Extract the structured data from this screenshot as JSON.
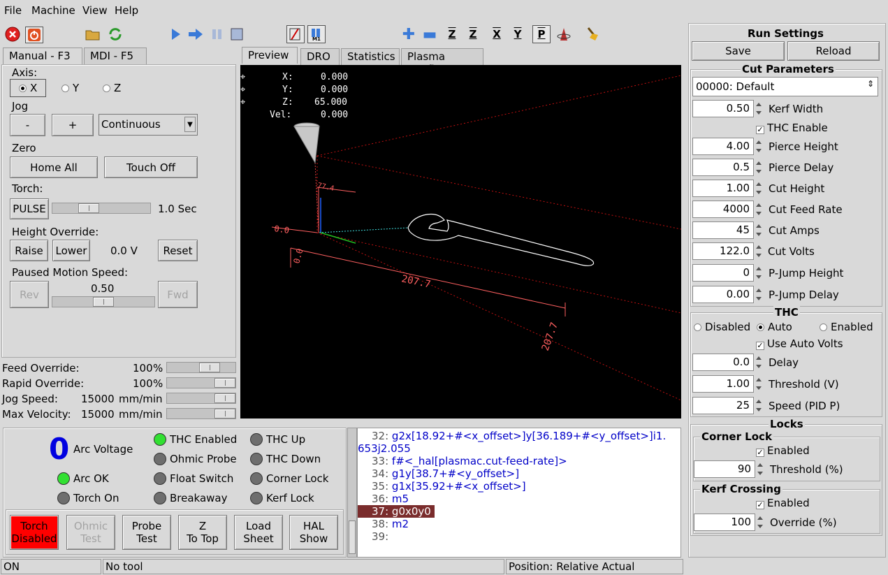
{
  "menu": [
    "File",
    "Machine",
    "View",
    "Help"
  ],
  "left_tabs": [
    "Manual - F3",
    "MDI - F5"
  ],
  "center_tabs": [
    "Preview",
    "DRO",
    "Statistics",
    "Plasma Config"
  ],
  "manual": {
    "axis_label": "Axis:",
    "axes": [
      "X",
      "Y",
      "Z"
    ],
    "jog_label": "Jog",
    "jog_minus": "-",
    "jog_plus": "+",
    "jog_mode": "Continuous",
    "zero_label": "Zero",
    "home_all": "Home All",
    "touch_off": "Touch Off",
    "torch_label": "Torch:",
    "pulse": "PULSE",
    "pulse_time": "1.0 Sec",
    "pulse_level": 0.3,
    "height_override_label": "Height Override:",
    "raise": "Raise",
    "lower": "Lower",
    "override_value": "0.0 V",
    "reset": "Reset",
    "paused_motion_label": "Paused Motion Speed:",
    "rev": "Rev",
    "fwd": "Fwd",
    "paused_speed": "0.50"
  },
  "overrides": [
    {
      "label": "Feed Override:",
      "value": "100",
      "unit": "%"
    },
    {
      "label": "Rapid Override:",
      "value": "100",
      "unit": "%"
    },
    {
      "label": "Jog Speed:",
      "value": "15000",
      "unit": "mm/min"
    },
    {
      "label": "Max Velocity:",
      "value": "15000",
      "unit": "mm/min"
    }
  ],
  "dro": {
    "x_label": "X:",
    "x": "0.000",
    "y_label": "Y:",
    "y": "0.000",
    "z_label": "Z:",
    "z": "65.000",
    "vel_label": "Vel:",
    "vel": "0.000"
  },
  "preview_dims": {
    "x_len": "207.7",
    "y_len": "207.7",
    "origin_x": "0.0",
    "origin_y": "0.0",
    "z_len": "77.4"
  },
  "status_panel": {
    "arc_voltage_value": "0",
    "arc_voltage_label": "Arc Voltage",
    "leds": [
      {
        "label": "Arc OK",
        "state": "green"
      },
      {
        "label": "Torch On",
        "state": "off"
      },
      {
        "label": "THC Enabled",
        "state": "green"
      },
      {
        "label": "Ohmic Probe",
        "state": "off"
      },
      {
        "label": "Float Switch",
        "state": "off"
      },
      {
        "label": "Breakaway",
        "state": "off"
      },
      {
        "label": "THC Up",
        "state": "off"
      },
      {
        "label": "THC Down",
        "state": "off"
      },
      {
        "label": "Corner Lock",
        "state": "off"
      },
      {
        "label": "Kerf Lock",
        "state": "off"
      }
    ],
    "buttons": [
      {
        "l1": "Torch",
        "l2": "Disabled"
      },
      {
        "l1": "Ohmic",
        "l2": "Test"
      },
      {
        "l1": "Probe",
        "l2": "Test"
      },
      {
        "l1": "Z",
        "l2": "To Top"
      },
      {
        "l1": "Load",
        "l2": "Sheet"
      },
      {
        "l1": "HAL",
        "l2": "Show"
      }
    ]
  },
  "gcode": [
    {
      "n": "32:",
      "code": "g2x[18.92+#<x_offset>]y[36.189+#<y_offset>]i1."
    },
    {
      "n": "",
      "code": "653j2.055"
    },
    {
      "n": "33:",
      "code": "f#<_hal[plasmac.cut-feed-rate]>"
    },
    {
      "n": "34:",
      "code": "g1y[38.7+#<y_offset>]"
    },
    {
      "n": "35:",
      "code": "g1x[35.92+#<x_offset>]"
    },
    {
      "n": "36:",
      "code": "m5"
    },
    {
      "n": "37:",
      "code": "g0x0y0"
    },
    {
      "n": "38:",
      "code": "m2"
    },
    {
      "n": "39:",
      "code": ""
    }
  ],
  "run_settings": {
    "title": "Run Settings",
    "save": "Save",
    "reload": "Reload",
    "cut_params_title": "Cut Parameters",
    "material": "00000: Default",
    "kerf_width": "0.50",
    "kerf_width_label": "Kerf Width",
    "thc_enable_label": "THC Enable",
    "pierce_height": "4.00",
    "pierce_height_label": "Pierce Height",
    "pierce_delay": "0.5",
    "pierce_delay_label": "Pierce Delay",
    "cut_height": "1.00",
    "cut_height_label": "Cut Height",
    "cut_feed_rate": "4000",
    "cut_feed_rate_label": "Cut Feed Rate",
    "cut_amps": "45",
    "cut_amps_label": "Cut Amps",
    "cut_volts": "122.0",
    "cut_volts_label": "Cut Volts",
    "pjump_height": "0",
    "pjump_height_label": "P-Jump Height",
    "pjump_delay": "0.00",
    "pjump_delay_label": "P-Jump Delay",
    "thc_title": "THC",
    "thc_modes": [
      "Disabled",
      "Auto",
      "Enabled"
    ],
    "use_auto_volts_label": "Use Auto Volts",
    "thc_delay": "0.0",
    "thc_delay_label": "Delay",
    "thc_threshold": "1.00",
    "thc_threshold_label": "Threshold (V)",
    "thc_speed": "25",
    "thc_speed_label": "Speed (PID P)",
    "locks_title": "Locks",
    "corner_lock_title": "Corner Lock",
    "corner_enabled_label": "Enabled",
    "corner_threshold": "90",
    "corner_threshold_label": "Threshold (%)",
    "kerf_crossing_title": "Kerf Crossing",
    "kerf_enabled_label": "Enabled",
    "kerf_override": "100",
    "kerf_override_label": "Override (%)"
  },
  "statusbar": {
    "state": "ON",
    "tool": "No tool",
    "position": "Position: Relative Actual"
  },
  "colors": {
    "preview_bg": "#000000",
    "torch_disabled": "#ff0000",
    "highlight_line": "#7a2c2c",
    "gcode_text": "#0000c8"
  }
}
